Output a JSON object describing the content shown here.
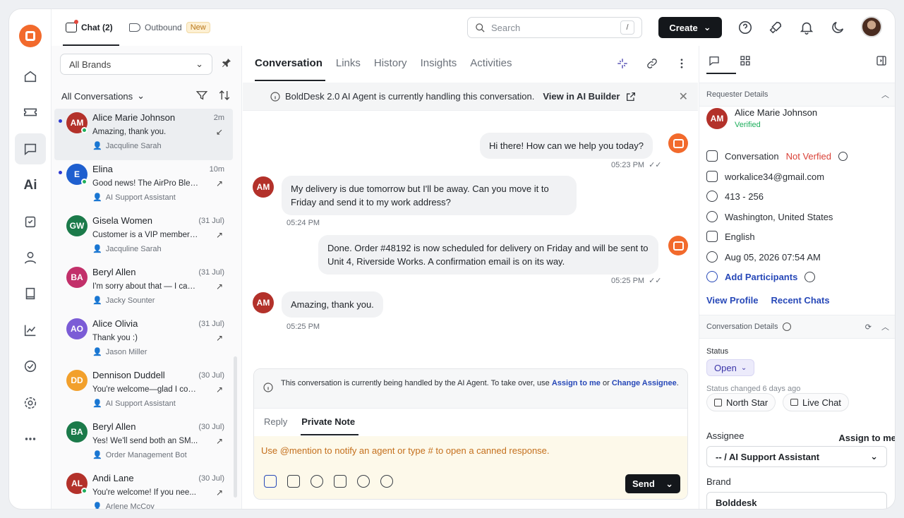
{
  "topbar": {
    "chat_tab": "Chat (2)",
    "outbound_tab": "Outbound",
    "new_badge": "New",
    "search_placeholder": "Search",
    "search_shortcut": "/",
    "create_label": "Create"
  },
  "list": {
    "brand_filter": "All Brands",
    "conversation_filter": "All Conversations",
    "items": [
      {
        "initials": "AM",
        "name": "Alice Marie Johnson",
        "time": "2m",
        "snippet": "Amazing, thank you.",
        "agent": "Jacquline Sarah",
        "color": "#b3312a",
        "unread": true,
        "online": true
      },
      {
        "initials": "E",
        "name": "Elina",
        "time": "10m",
        "snippet": "Good news! The AirPro Blen...",
        "agent": "AI Support Assistant",
        "color": "#1f5fcf",
        "unread": true,
        "online": true
      },
      {
        "initials": "GW",
        "name": "Gisela Women",
        "time": "(31 Jul)",
        "snippet": "Customer is a VIP members...",
        "agent": "Jacquline Sarah",
        "color": "#1b7a4a",
        "unread": false,
        "online": false
      },
      {
        "initials": "BA",
        "name": "Beryl Allen",
        "time": "(31 Jul)",
        "snippet": "I'm sorry about that — I can...",
        "agent": "Jacky Sounter",
        "color": "#c2306a",
        "unread": false,
        "online": false
      },
      {
        "initials": "AO",
        "name": "Alice Olivia",
        "time": "(31 Jul)",
        "snippet": "Thank you :)",
        "agent": "Jason Miller",
        "color": "#7b5cd6",
        "unread": false,
        "online": false
      },
      {
        "initials": "DD",
        "name": "Dennison Duddell",
        "time": "(30 Jul)",
        "snippet": "You're welcome—glad I cou...",
        "agent": "AI Support Assistant",
        "color": "#f2a02c",
        "unread": false,
        "online": false
      },
      {
        "initials": "BA",
        "name": "Beryl Allen",
        "time": "(30 Jul)",
        "snippet": "Yes! We'll send both an SM...",
        "agent": "Order Management Bot",
        "color": "#1b7a4a",
        "unread": false,
        "online": false
      },
      {
        "initials": "AL",
        "name": "Andi Lane",
        "time": "(30 Jul)",
        "snippet": "You're welcome! If you nee...",
        "agent": "Arlene McCoy",
        "color": "#b3312a",
        "unread": false,
        "online": true
      }
    ]
  },
  "center": {
    "tabs": [
      "Conversation",
      "Links",
      "History",
      "Insights",
      "Activities"
    ],
    "banner_text": "BoldDesk 2.0 AI Agent is currently handling this conversation.",
    "banner_link": "View in AI Builder",
    "messages": {
      "m1": "Hi there! How can we help you today?",
      "m1_time": "05:23 PM",
      "m2": "My delivery is due tomorrow but I'll be away. Can you move it to Friday and send it to my work address?",
      "m2_time": "05:24 PM",
      "m3": "Done. Order #48192 is now scheduled for delivery on Friday and will be sent to Unit 4, Riverside Works. A confirmation email is on its way.",
      "m3_time": "05:25 PM",
      "m4": "Amazing, thank you.",
      "m4_time": "05:25 PM",
      "user_initials": "AM"
    },
    "composer": {
      "ai_note": "This conversation is currently being handled by the AI Agent. To take over, use",
      "assign_link": "Assign to me",
      "or_text": "or",
      "change_link": "Change Assignee",
      "period": ".",
      "reply_tab": "Reply",
      "note_tab": "Private Note",
      "placeholder": "Use @mention to notify an agent or type # to open a canned response.",
      "send_label": "Send"
    }
  },
  "right": {
    "requester_header": "Requester Details",
    "initials": "AM",
    "name": "Alice Marie Johnson",
    "verified": "Verified",
    "conversation_label": "Conversation",
    "not_verified": "Not Verfied",
    "email": "workalice34@gmail.com",
    "phone": "413 - 256",
    "location": "Washington, United States",
    "language": "English",
    "date": "Aug 05, 2026 07:54 AM",
    "add_participants": "Add Participants",
    "view_profile": "View Profile",
    "recent_chats": "Recent Chats",
    "details_header": "Conversation Details",
    "status_label": "Status",
    "status_value": "Open",
    "status_changed": "Status changed 6 days ago",
    "chip1": "North Star",
    "chip2": "Live Chat",
    "assignee_label": "Assignee",
    "assign_to_me": "Assign to me",
    "assignee_value": "-- / AI Support Assistant",
    "brand_label": "Brand",
    "brand_value": "Bolddesk"
  }
}
